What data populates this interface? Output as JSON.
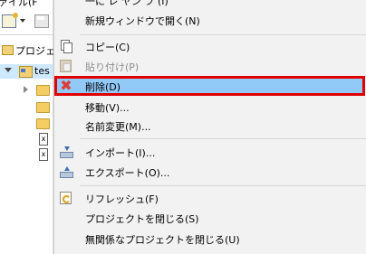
{
  "window": {
    "menubar_fragment": "ァイル(F",
    "view_title_fragment": "プロジェク",
    "tree": {
      "project_label": "tes",
      "items": [
        "folder",
        "folder",
        "folder",
        "folder",
        "file-x",
        "file-x"
      ]
    }
  },
  "context_menu": {
    "top_cut_label": "一に レ ヤン フ (I)",
    "items": [
      {
        "id": "open-new-window",
        "label": "新規ウィンドウで開く(N)",
        "icon": "",
        "disabled": false
      },
      {
        "id": "copy",
        "label": "コピー(C)",
        "icon": "copy-icon",
        "disabled": false
      },
      {
        "id": "paste",
        "label": "貼り付け(P)",
        "icon": "paste-icon",
        "disabled": true
      },
      {
        "id": "delete",
        "label": "削除(D)",
        "icon": "delete-icon",
        "disabled": false,
        "selected": true
      },
      {
        "id": "move",
        "label": "移動(V)...",
        "icon": "",
        "disabled": false
      },
      {
        "id": "rename",
        "label": "名前変更(M)...",
        "icon": "",
        "disabled": false
      },
      {
        "id": "import",
        "label": "インポート(I)...",
        "icon": "import-icon",
        "disabled": false
      },
      {
        "id": "export",
        "label": "エクスポート(O)...",
        "icon": "export-icon",
        "disabled": false
      },
      {
        "id": "refresh",
        "label": "リフレッシュ(F)",
        "icon": "refresh-icon",
        "disabled": false
      },
      {
        "id": "close-project",
        "label": "プロジェクトを閉じる(S)",
        "icon": "",
        "disabled": false
      },
      {
        "id": "close-unrelated",
        "label": "無関係なプロジェクトを閉じる(U)",
        "icon": "",
        "disabled": false
      }
    ]
  },
  "colors": {
    "menu_bg": "#f2f2f2",
    "selected_bg": "#91c9f7",
    "highlight_border": "#e00000",
    "tree_selection": "#cde8ff"
  }
}
